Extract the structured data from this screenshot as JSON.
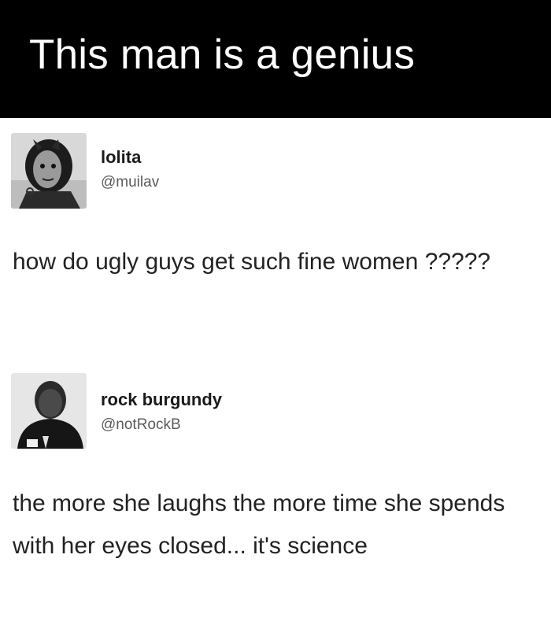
{
  "banner": {
    "title": "This man is a genius"
  },
  "tweets": [
    {
      "name": "lolita",
      "handle": "@muilav",
      "text": "how do ugly guys get such fine women ?????"
    },
    {
      "name": "rock burgundy",
      "handle": "@notRockB",
      "text": "the more she laughs the more time she spends with her eyes closed... it's science"
    }
  ]
}
